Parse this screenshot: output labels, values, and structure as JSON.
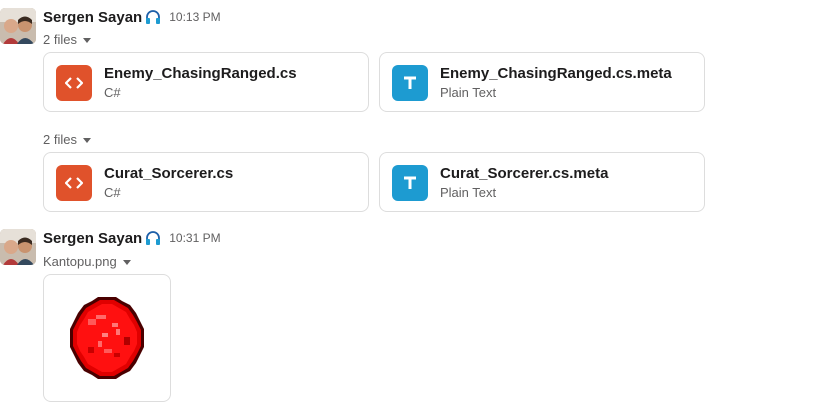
{
  "messages": [
    {
      "author": "Sergen Sayan",
      "time": "10:13 PM",
      "groups": [
        {
          "toggle_label": "2 files",
          "files": [
            {
              "name": "Enemy_ChasingRanged.cs",
              "type": "C#",
              "icon": "code-icon"
            },
            {
              "name": "Enemy_ChasingRanged.cs.meta",
              "type": "Plain Text",
              "icon": "text-icon"
            }
          ]
        },
        {
          "toggle_label": "2 files",
          "files": [
            {
              "name": "Curat_Sorcerer.cs",
              "type": "C#",
              "icon": "code-icon"
            },
            {
              "name": "Curat_Sorcerer.cs.meta",
              "type": "Plain Text",
              "icon": "text-icon"
            }
          ]
        }
      ]
    },
    {
      "author": "Sergen Sayan",
      "time": "10:31 PM",
      "image": {
        "name": "Kantopu.png"
      }
    }
  ],
  "colors": {
    "code_icon_bg": "#e0522b",
    "text_icon_bg": "#1d9bd1",
    "orb_red": "#e00000"
  }
}
